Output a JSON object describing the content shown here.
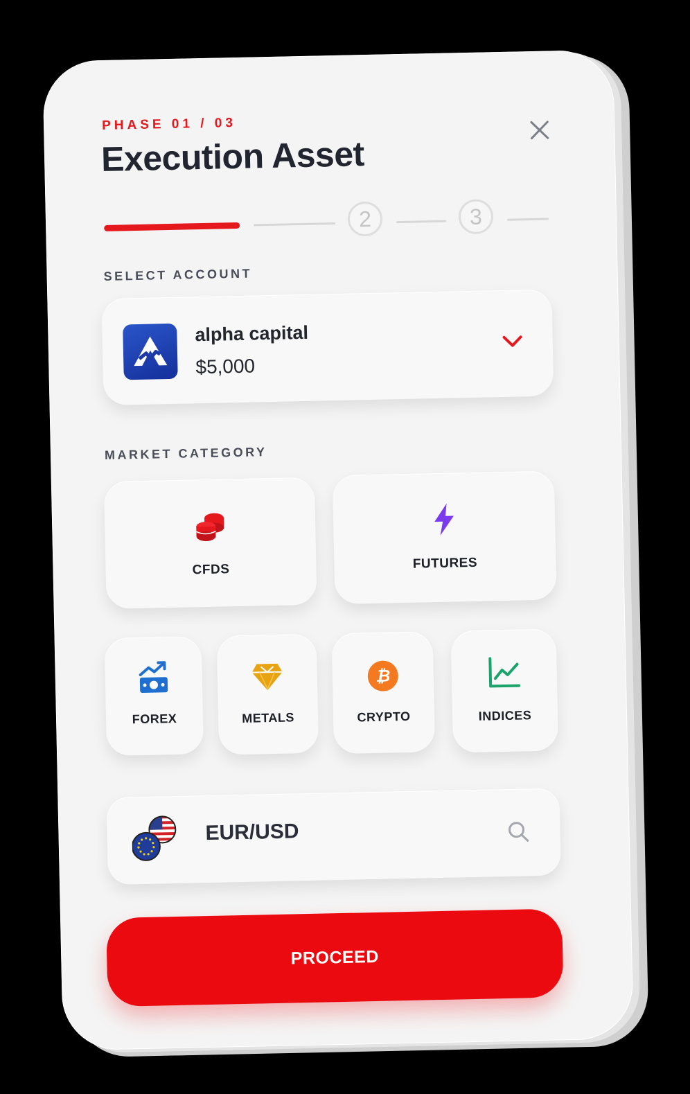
{
  "header": {
    "phase_label": "PHASE 01 / 03",
    "title": "Execution Asset"
  },
  "stepper": {
    "steps": [
      "2",
      "3"
    ]
  },
  "account_section": {
    "label": "SELECT ACCOUNT",
    "account_name": "alpha capital",
    "balance": "$5,000"
  },
  "market_section": {
    "label": "MARKET CATEGORY",
    "primary": [
      {
        "label": "CFDS",
        "icon": "coins-icon",
        "color": "#e5181e"
      },
      {
        "label": "FUTURES",
        "icon": "lightning-icon",
        "color": "#7c3aed"
      }
    ],
    "secondary": [
      {
        "label": "FOREX",
        "icon": "money-trend-icon",
        "color": "#1f6fd1"
      },
      {
        "label": "METALS",
        "icon": "gem-icon",
        "color": "#e8a313"
      },
      {
        "label": "CRYPTO",
        "icon": "bitcoin-icon",
        "color": "#f37a20"
      },
      {
        "label": "INDICES",
        "icon": "line-chart-icon",
        "color": "#1aa36b"
      }
    ]
  },
  "asset_search": {
    "pair": "EUR/USD",
    "icon": "search-icon"
  },
  "cta": {
    "label": "PROCEED",
    "color": "#ec0a11"
  }
}
